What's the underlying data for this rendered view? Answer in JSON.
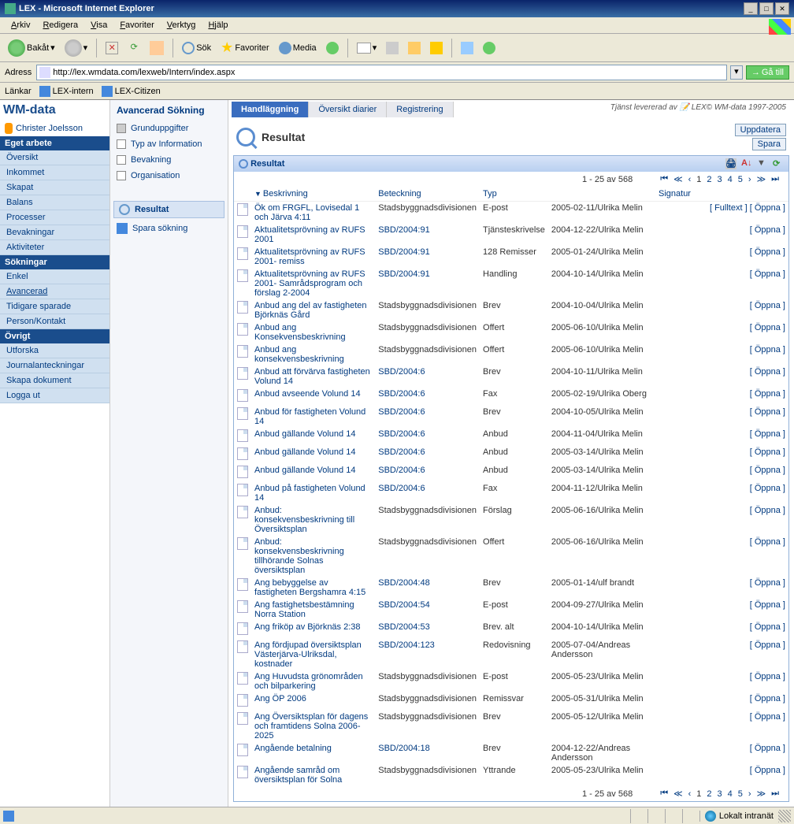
{
  "window": {
    "title": "LEX - Microsoft Internet Explorer"
  },
  "menubar": [
    "Arkiv",
    "Redigera",
    "Visa",
    "Favoriter",
    "Verktyg",
    "Hjälp"
  ],
  "toolbar": {
    "back": "Bakåt",
    "search": "Sök",
    "favorites": "Favoriter",
    "media": "Media"
  },
  "addressbar": {
    "label": "Adress",
    "url": "http://lex.wmdata.com/lexweb/Intern/index.aspx",
    "go": "Gå till"
  },
  "linksbar": {
    "label": "Länkar",
    "items": [
      "LEX-intern",
      "LEX-Citizen"
    ]
  },
  "logo": {
    "wm": "WM-",
    "data": "data"
  },
  "user": "Christer Joelsson",
  "leftnav": {
    "s1": {
      "title": "Eget arbete",
      "items": [
        "Översikt",
        "Inkommet",
        "Skapat",
        "Balans",
        "Processer",
        "Bevakningar",
        "Aktiviteter"
      ]
    },
    "s2": {
      "title": "Sökningar",
      "items": [
        "Enkel",
        "Avancerad",
        "Tidigare sparade",
        "Person/Kontakt"
      ]
    },
    "s3": {
      "title": "Övrigt",
      "items": [
        "Utforska",
        "Journalanteckningar",
        "Skapa dokument",
        "Logga ut"
      ]
    }
  },
  "tabs": [
    "Handläggning",
    "Översikt diarier",
    "Registrering"
  ],
  "footer": "Tjänst levererad av 📝 LEX© WM-data 1997-2005",
  "mid": {
    "title": "Avancerad Sökning",
    "items": [
      "Grunduppgifter",
      "Typ av Information",
      "Bevakning",
      "Organisation"
    ],
    "resultat": "Resultat",
    "spara": "Spara sökning"
  },
  "main": {
    "title": "Resultat",
    "uppdatera": "Uppdatera",
    "spara": "Spara",
    "panel_title": "Resultat",
    "pager_text": "1 - 25 av 568",
    "pages": [
      "1",
      "2",
      "3",
      "4",
      "5"
    ],
    "columns": [
      "Beskrivning",
      "Beteckning",
      "Typ",
      "",
      "Signatur"
    ],
    "fulltext": "Fulltext",
    "oppna": "Öppna",
    "rows": [
      {
        "desc": "Ök om FRGFL, Lovisedal 1 och Järva 4:11",
        "bet": "Stadsbyggnadsdivisionen",
        "typ": "E-post",
        "date": "2005-02-11/",
        "sig": "Ulrika Melin",
        "fulltext": true
      },
      {
        "desc": "Aktualitetsprövning av RUFS 2001",
        "bet": "SBD/2004:91",
        "typ": "Tjänsteskrivelse",
        "date": "2004-12-22/",
        "sig": "Ulrika Melin"
      },
      {
        "desc": "Aktualitetsprövning av RUFS 2001- remiss",
        "bet": "SBD/2004:91",
        "typ": "128 Remisser",
        "date": "2005-01-24/",
        "sig": "Ulrika Melin"
      },
      {
        "desc": "Aktualitetsprövning av RUFS 2001- Samrådsprogram och förslag 2-2004",
        "bet": "SBD/2004:91",
        "typ": "Handling",
        "date": "2004-10-14/",
        "sig": "Ulrika Melin"
      },
      {
        "desc": "Anbud ang del av fastigheten Björknäs Gård",
        "bet": "Stadsbyggnadsdivisionen",
        "typ": "Brev",
        "date": "2004-10-04/",
        "sig": "Ulrika Melin"
      },
      {
        "desc": "Anbud ang Konsekvensbeskrivning",
        "bet": "Stadsbyggnadsdivisionen",
        "typ": "Offert",
        "date": "2005-06-10/",
        "sig": "Ulrika Melin"
      },
      {
        "desc": "Anbud ang konsekvensbeskrivning",
        "bet": "Stadsbyggnadsdivisionen",
        "typ": "Offert",
        "date": "2005-06-10/",
        "sig": "Ulrika Melin"
      },
      {
        "desc": "Anbud att förvärva fastigheten Volund 14",
        "bet": "SBD/2004:6",
        "typ": "Brev",
        "date": "2004-10-11/",
        "sig": "Ulrika Melin"
      },
      {
        "desc": "Anbud avseende Volund 14",
        "bet": "SBD/2004:6",
        "typ": "Fax",
        "date": "2005-02-19/",
        "sig": "Ulrika Oberg"
      },
      {
        "desc": "Anbud för fastigheten Volund 14",
        "bet": "SBD/2004:6",
        "typ": "Brev",
        "date": "2004-10-05/",
        "sig": "Ulrika Melin"
      },
      {
        "desc": "Anbud gällande Volund 14",
        "bet": "SBD/2004:6",
        "typ": "Anbud",
        "date": "2004-11-04/",
        "sig": "Ulrika Melin"
      },
      {
        "desc": "Anbud gällande Volund 14",
        "bet": "SBD/2004:6",
        "typ": "Anbud",
        "date": "2005-03-14/",
        "sig": "Ulrika Melin"
      },
      {
        "desc": "Anbud gällande Volund 14",
        "bet": "SBD/2004:6",
        "typ": "Anbud",
        "date": "2005-03-14/",
        "sig": "Ulrika Melin"
      },
      {
        "desc": "Anbud på fastigheten Volund 14",
        "bet": "SBD/2004:6",
        "typ": "Fax",
        "date": "2004-11-12/",
        "sig": "Ulrika Melin"
      },
      {
        "desc": "Anbud: konsekvensbeskrivning till Översiktsplan",
        "bet": "Stadsbyggnadsdivisionen",
        "typ": "Förslag",
        "date": "2005-06-16/",
        "sig": "Ulrika Melin"
      },
      {
        "desc": "Anbud: konsekvensbeskrivning tillhörande Solnas översiktsplan",
        "bet": "Stadsbyggnadsdivisionen",
        "typ": "Offert",
        "date": "2005-06-16/",
        "sig": "Ulrika Melin"
      },
      {
        "desc": "Ang bebyggelse av fastigheten Bergshamra 4:15",
        "bet": "SBD/2004:48",
        "typ": "Brev",
        "date": "2005-01-14/",
        "sig": "ulf brandt"
      },
      {
        "desc": "Ang fastighetsbestämning Norra Station",
        "bet": "SBD/2004:54",
        "typ": "E-post",
        "date": "2004-09-27/",
        "sig": "Ulrika Melin"
      },
      {
        "desc": "Ang friköp av Björknäs 2:38",
        "bet": "SBD/2004:53",
        "typ": "Brev. alt",
        "date": "2004-10-14/",
        "sig": "Ulrika Melin"
      },
      {
        "desc": "Ang fördjupad översiktsplan Västerjärva-Ulriksdal, kostnader",
        "bet": "SBD/2004:123",
        "typ": "Redovisning",
        "date": "2005-07-04/",
        "sig": "Andreas Andersson"
      },
      {
        "desc": "Ang Huvudsta grönområden och bilparkering",
        "bet": "Stadsbyggnadsdivisionen",
        "typ": "E-post",
        "date": "2005-05-23/",
        "sig": "Ulrika Melin"
      },
      {
        "desc": "Ang ÖP 2006",
        "bet": "Stadsbyggnadsdivisionen",
        "typ": "Remissvar",
        "date": "2005-05-31/",
        "sig": "Ulrika Melin"
      },
      {
        "desc": "Ang Översiktsplan för dagens och framtidens Solna 2006-2025",
        "bet": "Stadsbyggnadsdivisionen",
        "typ": "Brev",
        "date": "2005-05-12/",
        "sig": "Ulrika Melin"
      },
      {
        "desc": "Angående betalning",
        "bet": "SBD/2004:18",
        "typ": "Brev",
        "date": "2004-12-22/",
        "sig": "Andreas Andersson"
      },
      {
        "desc": "Angående samråd om översiktsplan för Solna",
        "bet": "Stadsbyggnadsdivisionen",
        "typ": "Yttrande",
        "date": "2005-05-23/",
        "sig": "Ulrika Melin"
      }
    ]
  },
  "statusbar": {
    "zone": "Lokalt intranät"
  }
}
